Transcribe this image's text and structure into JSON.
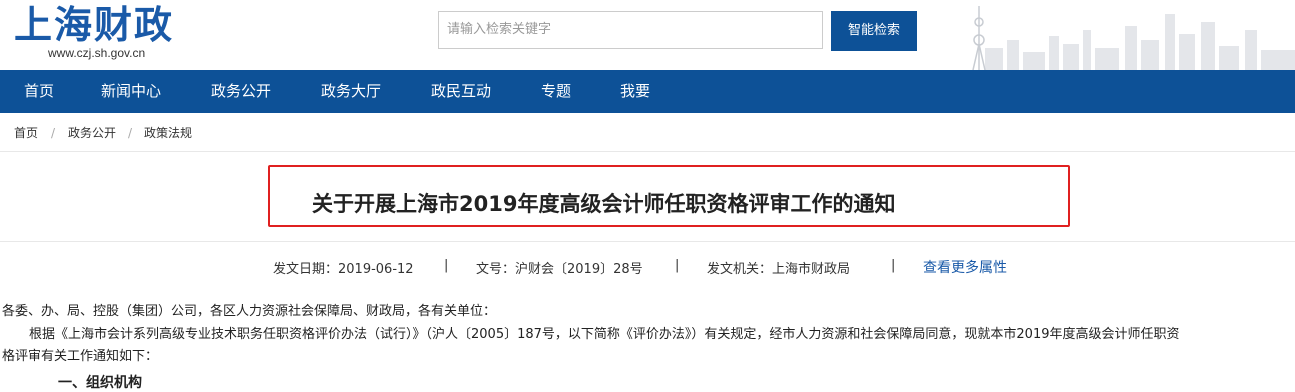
{
  "header": {
    "logo_text": "上海财政",
    "logo_url": "www.czj.sh.gov.cn",
    "search_placeholder": "请输入检索关键字",
    "search_button": "智能检索"
  },
  "nav": {
    "items": [
      "首页",
      "新闻中心",
      "政务公开",
      "政务大厅",
      "政民互动",
      "专题",
      "我要"
    ]
  },
  "breadcrumb": {
    "items": [
      "首页",
      "政务公开",
      "政策法规"
    ],
    "separator": "/"
  },
  "article": {
    "title": "关于开展上海市2019年度高级会计师任职资格评审工作的通知",
    "meta": {
      "date": "发文日期：2019-06-12",
      "doc_no": "文号：沪财会〔2019〕28号",
      "issuer": "发文机关：上海市财政局",
      "more_link": "查看更多属性",
      "divider": "|"
    },
    "paragraphs": [
      "各委、办、局、控股（集团）公司，各区人力资源社会保障局、财政局，各有关单位：",
      "根据《上海市会计系列高级专业技术职务任职资格评价办法（试行）》（沪人〔2005〕187号，以下简称《评价办法》）有关规定，经市人力资源和社会保障局同意，现就本市2019年度高级会计师任职资",
      "格评审有关工作通知如下：",
      "一、组织机构"
    ]
  },
  "colors": {
    "brand_blue": "#0d5197",
    "title_box_red": "#e02020",
    "link_blue": "#1a5aa8"
  }
}
